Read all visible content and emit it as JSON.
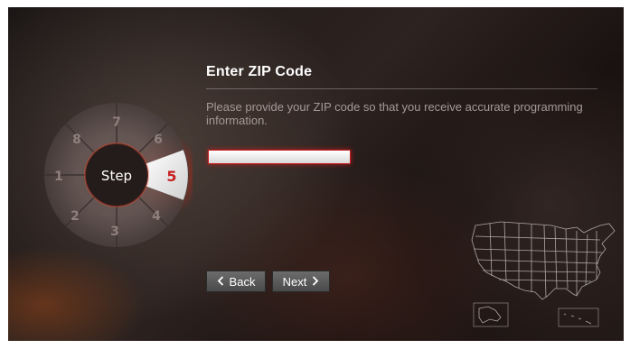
{
  "wizard": {
    "center_label": "Step",
    "current_step": "5",
    "steps": [
      "1",
      "2",
      "3",
      "4",
      "6",
      "7",
      "8"
    ]
  },
  "page": {
    "title": "Enter ZIP Code",
    "description": "Please provide your ZIP code so that you receive accurate programming information."
  },
  "form": {
    "zip_value": ""
  },
  "nav": {
    "back_label": "Back",
    "next_label": "Next",
    "back_icon": "chevron-left-icon",
    "next_icon": "chevron-right-icon"
  },
  "colors": {
    "accent": "#c71f1f",
    "active_step_number": "#c71f1f"
  }
}
